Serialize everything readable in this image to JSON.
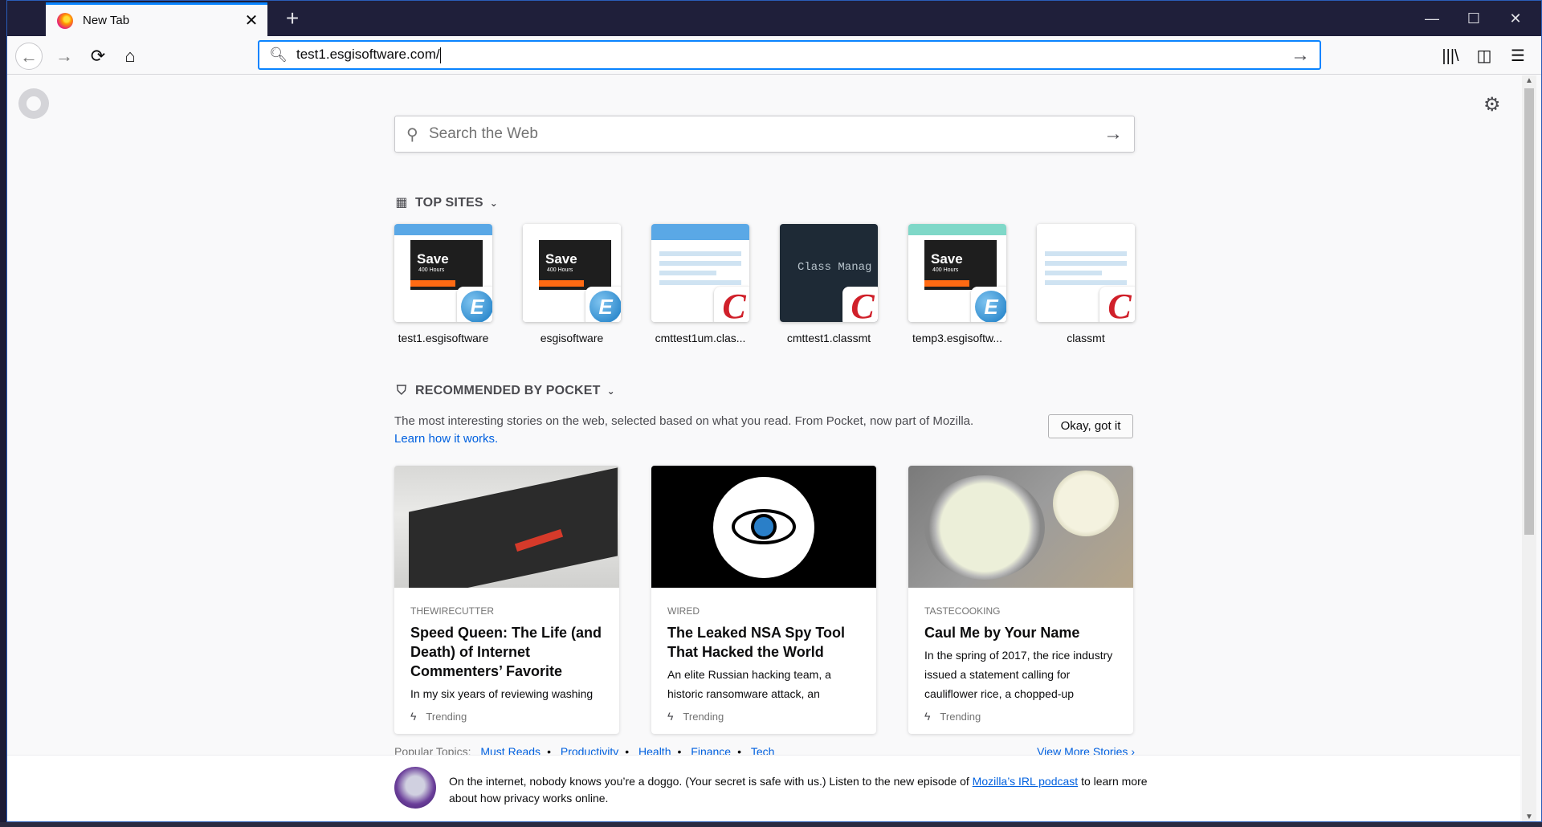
{
  "browser": {
    "tab_title": "New Tab",
    "new_tab_symbol": "+",
    "window_controls": {
      "minimize": "—",
      "maximize": "☐",
      "close": "✕"
    },
    "url": "test1.esgisoftware.com/",
    "icons": [
      "back-icon",
      "forward-icon",
      "reload-icon",
      "home-icon",
      "library-icon",
      "sidebar-icon",
      "menu-icon"
    ]
  },
  "newtab": {
    "search_placeholder": "Search the Web",
    "top_sites_title": "TOP SITES",
    "top_sites": [
      {
        "label": "test1.esgisoftware",
        "kind": "esgi",
        "badge": "E"
      },
      {
        "label": "esgisoftware",
        "kind": "esgi",
        "badge": "E"
      },
      {
        "label": "cmttest1um.clas...",
        "kind": "cmt",
        "badge": "C"
      },
      {
        "label": "cmttest1.classmt",
        "kind": "dark",
        "badge": "C",
        "preview_text": "Class Manag"
      },
      {
        "label": "temp3.esgisoftw...",
        "kind": "esgi",
        "badge": "E"
      },
      {
        "label": "classmt",
        "kind": "cmt",
        "badge": "C"
      }
    ],
    "thumb_text": {
      "save": "Save",
      "hours": "400 Hours"
    },
    "pocket": {
      "title": "RECOMMENDED BY POCKET",
      "description": "The most interesting stories on the web, selected based on what you read. From Pocket, now part of Mozilla.",
      "learn_link": "Learn how it works.",
      "okay_button": "Okay, got it",
      "stories": [
        {
          "source": "THEWIRECUTTER",
          "title": "Speed Queen: The Life (and Death) of Internet Commenters’ Favorite",
          "excerpt": "In my six years of reviewing washing",
          "tag": "Trending"
        },
        {
          "source": "WIRED",
          "title": "The Leaked NSA Spy Tool That Hacked the World",
          "excerpt": "An elite Russian hacking team, a historic ransomware attack, an",
          "tag": "Trending"
        },
        {
          "source": "TASTECOOKING",
          "title": "Caul Me by Your Name",
          "excerpt": "In the spring of 2017, the rice industry issued a statement calling for cauliflower rice, a chopped-up",
          "tag": "Trending"
        }
      ],
      "popular_topics_label": "Popular Topics:",
      "topics": [
        "Must Reads",
        "Productivity",
        "Health",
        "Finance",
        "Tech"
      ],
      "view_more": "View More Stories"
    },
    "snippet": {
      "text_before": "On the internet, nobody knows you’re a doggo. (Your secret is safe with us.) Listen to the new episode of",
      "link": "Mozilla’s IRL podcast",
      "text_after": "to learn more about how privacy works online."
    }
  },
  "colors": {
    "accent": "#0a84ff",
    "link": "#0060df",
    "titlebar": "#1f1f3a"
  }
}
